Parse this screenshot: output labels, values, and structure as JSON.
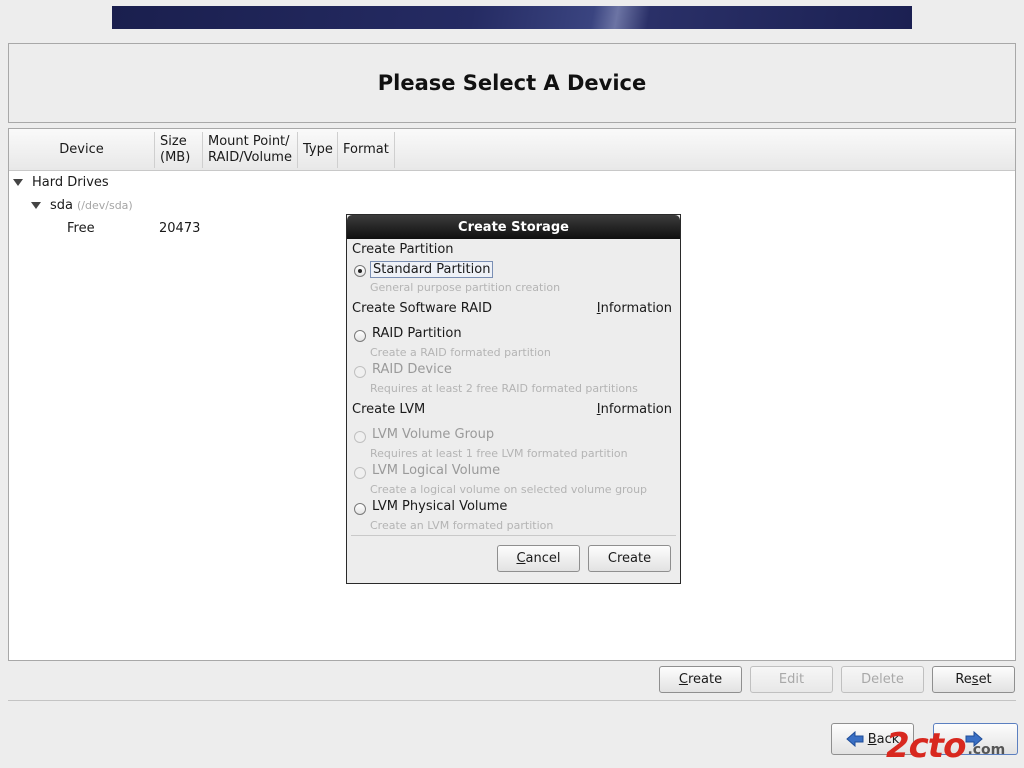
{
  "header": {
    "title": "Please Select A Device"
  },
  "table": {
    "columns": [
      "Device",
      "Size (MB)",
      "Mount Point/ RAID/Volume",
      "Type",
      "Format"
    ],
    "col_size_line1": "Size",
    "col_size_line2": "(MB)",
    "col_mount_line1": "Mount Point/",
    "col_mount_line2": "RAID/Volume",
    "tree": {
      "root_label": "Hard Drives",
      "disk_label": "sda",
      "disk_path": "(/dev/sda)",
      "free_label": "Free",
      "free_size": "20473"
    }
  },
  "dialog": {
    "title": "Create Storage",
    "partition_section": "Create Partition",
    "standard_partition": "Standard Partition",
    "standard_partition_desc": "General purpose partition creation",
    "raid_section": "Create Software RAID",
    "info_label_first": "I",
    "info_label_rest": "nformation",
    "raid_partition": "RAID Partition",
    "raid_partition_desc": "Create a RAID formated partition",
    "raid_device": "RAID Device",
    "raid_device_desc": "Requires at least 2 free RAID formated partitions",
    "lvm_section": "Create LVM",
    "lvm_volume_group": "LVM Volume Group",
    "lvm_volume_group_desc": "Requires at least 1 free LVM formated partition",
    "lvm_logical_volume": "LVM Logical Volume",
    "lvm_logical_volume_desc": "Create a logical volume on selected volume group",
    "lvm_physical_volume": "LVM Physical Volume",
    "lvm_physical_volume_desc": "Create an LVM formated partition",
    "cancel_first": "C",
    "cancel_rest": "ancel",
    "create_label": "Create"
  },
  "actions": {
    "create_first": "C",
    "create_rest": "reate",
    "edit": "Edit",
    "delete": "Delete",
    "reset_first": "Re",
    "reset_mn": "s",
    "reset_rest": "et"
  },
  "nav": {
    "back_first": "B",
    "back_rest": "ack"
  },
  "watermark": {
    "logo": "2cto",
    "text": ".com"
  }
}
